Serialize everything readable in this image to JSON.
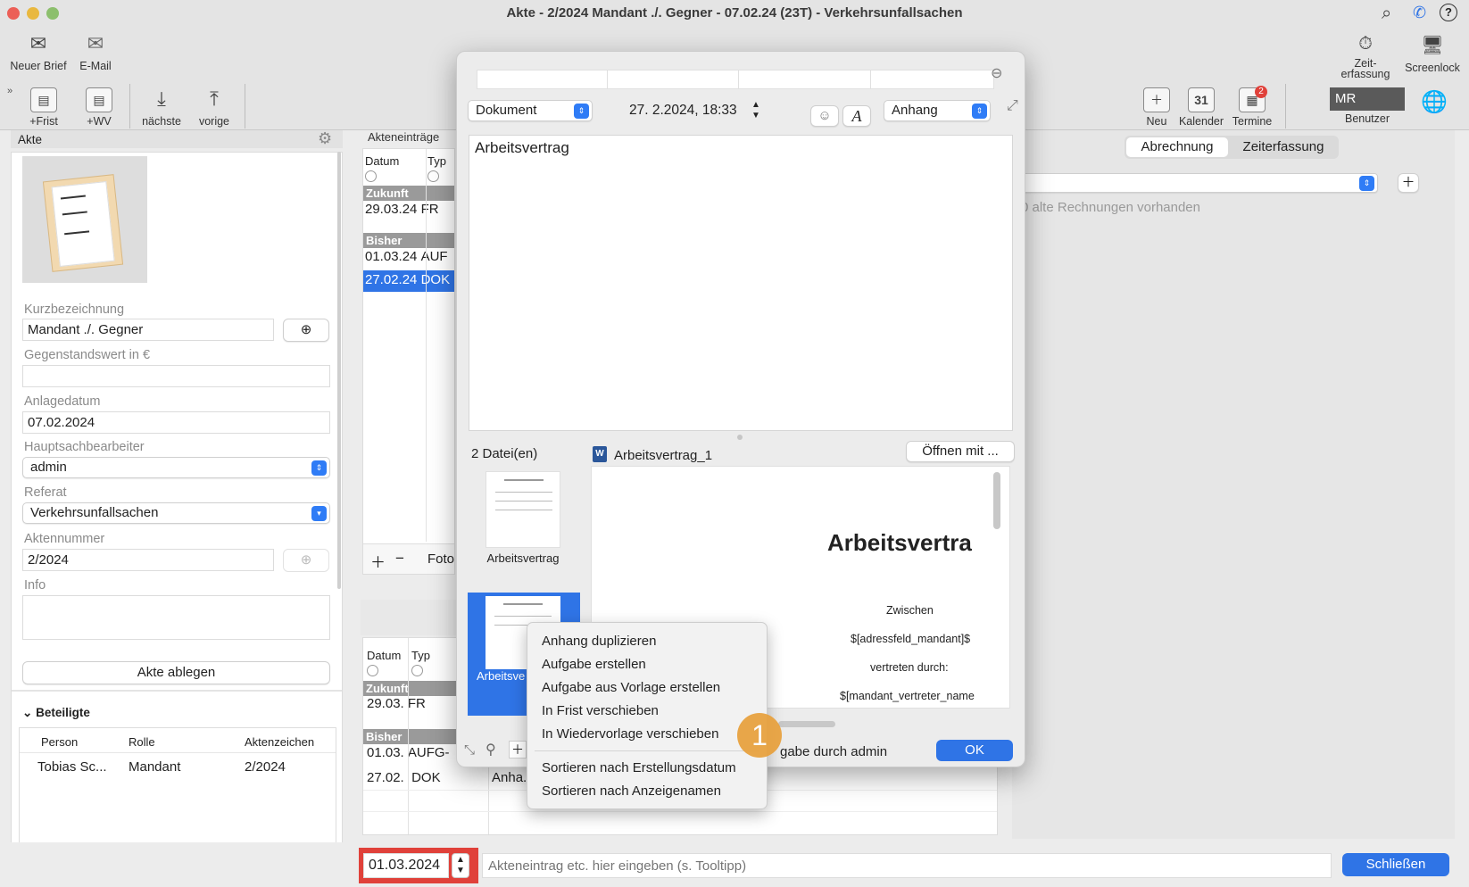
{
  "window": {
    "title": "Akte - 2/2024 Mandant ./. Gegner - 07.02.24 (23T) - Verkehrsunfallsachen"
  },
  "toolbar": {
    "new_letter": "Neuer Brief",
    "email": "E-Mail",
    "frist": "+Frist",
    "wv": "+WV",
    "next": "nächste",
    "prev": "vorige",
    "zeiterfassung": "Zeit-\nerfassung",
    "screenlock": "Screenlock",
    "neu": "Neu",
    "kalender": "Kalender",
    "kalender_day": "31",
    "termine": "Termine",
    "termine_badge": "2",
    "user_initials": "MR",
    "benutzer": "Benutzer"
  },
  "left": {
    "header": "Akte",
    "kurz_label": "Kurzbezeichnung",
    "kurz_value": "Mandant ./. Gegner",
    "gegen_label": "Gegenstandswert in €",
    "gegen_value": "",
    "anlage_label": "Anlagedatum",
    "anlage_value": "07.02.2024",
    "haupt_label": "Hauptsachbearbeiter",
    "haupt_value": "admin",
    "referat_label": "Referat",
    "referat_value": "Verkehrsunfallsachen",
    "akten_label": "Aktennummer",
    "akten_value": "2/2024",
    "info_label": "Info",
    "ablegen_button": "Akte ablegen",
    "beteiligte_header": "Beteiligte",
    "columns": [
      "Person",
      "Rolle",
      "Aktenzeichen"
    ],
    "rows": [
      {
        "person": "Tobias Sc...",
        "rolle": "Mandant",
        "az": "2/2024"
      }
    ]
  },
  "entries": {
    "header": "Akteneinträge",
    "col_datum": "Datum",
    "col_typ": "Typ",
    "group_future": "Zukunft",
    "group_past": "Bisher",
    "rows_top": [
      {
        "date": "29.03.24",
        "type": "FR"
      },
      {
        "date": "01.03.24",
        "type": "AUF"
      },
      {
        "date": "27.02.24",
        "type": "DOK"
      }
    ],
    "foto": "Foto",
    "rows_bottom": [
      {
        "date": "29.03.",
        "type": "FR"
      },
      {
        "date": "01.03.",
        "type": "AUFG-"
      },
      {
        "date": "27.02.",
        "type": "DOK",
        "extra": "Anha."
      }
    ]
  },
  "right": {
    "tab_abrechnung": "Abrechnung",
    "tab_zeit": "Zeiterfassung",
    "alte_rechnungen": "0 alte Rechnungen vorhanden"
  },
  "bottom": {
    "date": "01.03.2024",
    "input_placeholder": "Akteneintrag etc. hier eingeben (s. Tooltipp)",
    "close_button": "Schließen"
  },
  "dialog": {
    "type_select": "Dokument",
    "datetime": "27.  2.2024, 18:33",
    "category_select": "Anhang",
    "text": "Arbeitsvertrag",
    "file_count": "2 Datei(en)",
    "thumb1_label": "Arbeitsvertrag",
    "thumb2_label": "Arbeitsve",
    "preview_file": "Arbeitsvertrag_1",
    "open_with": "Öffnen mit ...",
    "preview_title": "Arbeitsvertra",
    "preview_lines": [
      "Zwischen",
      "$[adressfeld_mandant]$",
      "vertreten durch:",
      "$[mandant_vertreter_name"
    ],
    "footer_text": "gabe durch admin",
    "ok_button": "OK"
  },
  "context_menu": {
    "items": [
      "Anhang duplizieren",
      "Aufgabe erstellen",
      "Aufgabe aus Vorlage erstellen",
      "In Frist verschieben",
      "In Wiedervorlage verschieben"
    ],
    "sort_items": [
      "Sortieren nach Erstellungsdatum",
      "Sortieren nach Anzeigenamen"
    ],
    "step_badge": "1"
  },
  "colors": {
    "accent": "#2f74e6",
    "highlight_red": "#e0413a",
    "badge_orange": "#e8a03b"
  }
}
